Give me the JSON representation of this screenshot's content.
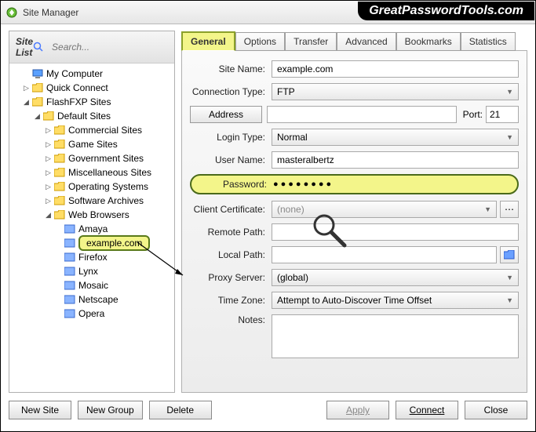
{
  "watermark": "GreatPasswordTools.com",
  "window": {
    "title": "Site Manager"
  },
  "sidebar": {
    "header": "Site List",
    "search_placeholder": "Search...",
    "nodes": {
      "mycomputer": "My Computer",
      "quickconnect": "Quick Connect",
      "flashfxp": "FlashFXP Sites",
      "default": "Default Sites",
      "commercial": "Commercial Sites",
      "game": "Game Sites",
      "government": "Government Sites",
      "misc": "Miscellaneous Sites",
      "os": "Operating Systems",
      "software": "Software Archives",
      "web": "Web Browsers",
      "amaya": "Amaya",
      "example": "example.com",
      "firefox": "Firefox",
      "lynx": "Lynx",
      "mosaic": "Mosaic",
      "netscape": "Netscape",
      "opera": "Opera"
    }
  },
  "tabs": {
    "general": "General",
    "options": "Options",
    "transfer": "Transfer",
    "advanced": "Advanced",
    "bookmarks": "Bookmarks",
    "statistics": "Statistics"
  },
  "form": {
    "site_name_label": "Site Name:",
    "site_name_value": "example.com",
    "conn_type_label": "Connection Type:",
    "conn_type_value": "FTP",
    "address_btn": "Address",
    "address_value": "",
    "port_label": "Port:",
    "port_value": "21",
    "login_type_label": "Login Type:",
    "login_type_value": "Normal",
    "username_label": "User Name:",
    "username_value": "masteralbertz",
    "password_label": "Password:",
    "password_value": "●●●●●●●●",
    "client_cert_label": "Client Certificate:",
    "client_cert_value": "(none)",
    "remote_path_label": "Remote Path:",
    "remote_path_value": "",
    "local_path_label": "Local Path:",
    "local_path_value": "",
    "proxy_label": "Proxy Server:",
    "proxy_value": "(global)",
    "timezone_label": "Time Zone:",
    "timezone_value": "Attempt to Auto-Discover Time Offset",
    "notes_label": "Notes:",
    "notes_value": ""
  },
  "footer": {
    "new_site": "New Site",
    "new_group": "New Group",
    "delete": "Delete",
    "apply": "Apply",
    "connect": "Connect",
    "close": "Close"
  }
}
